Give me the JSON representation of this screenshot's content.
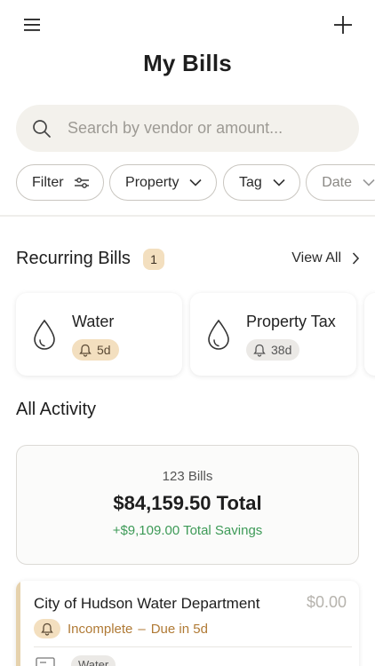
{
  "header": {
    "title": "My Bills"
  },
  "search": {
    "placeholder": "Search by vendor or amount..."
  },
  "filters": [
    {
      "label": "Filter"
    },
    {
      "label": "Property"
    },
    {
      "label": "Tag"
    },
    {
      "label": "Date"
    }
  ],
  "recurring": {
    "title": "Recurring Bills",
    "count": "1",
    "view_all": "View All",
    "items": [
      {
        "name": "Water",
        "due": "5d",
        "style": "warning"
      },
      {
        "name": "Property Tax",
        "due": "38d",
        "style": "neutral"
      }
    ]
  },
  "activity": {
    "title": "All Activity",
    "summary": {
      "count": "123 Bills",
      "total": "$84,159.50 Total",
      "savings": "+$9,109.00 Total Savings"
    },
    "bills": [
      {
        "vendor": "City of Hudson Water Department",
        "amount": "$0.00",
        "status": "Incomplete",
        "due": "Due in 5d",
        "tag": "Water"
      }
    ]
  },
  "colors": {
    "accent_warning": "#f3dfbf",
    "status_text": "#b07a35",
    "savings_green": "#3d9a57",
    "search_bg": "#f3f1ec"
  },
  "icons": {
    "menu": "menu-icon",
    "add": "plus-icon",
    "search": "search-icon",
    "filter": "sliders-icon",
    "chevron": "chevron-down-icon",
    "drop": "water-drop-icon",
    "bell": "bell-icon"
  }
}
